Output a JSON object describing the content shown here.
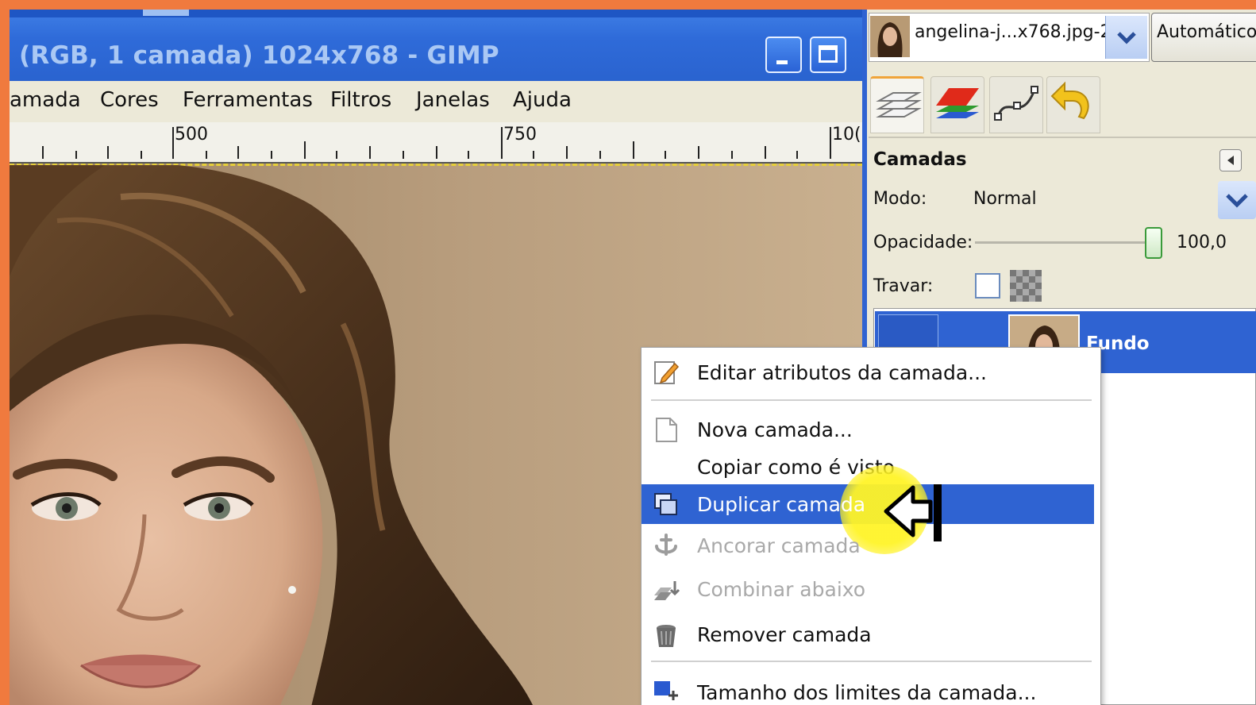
{
  "window": {
    "title": "(RGB, 1 camada) 1024x768 - GIMP"
  },
  "menubar": {
    "items": [
      "amada",
      "Cores",
      "Ferramentas",
      "Filtros",
      "Janelas",
      "Ajuda"
    ]
  },
  "ruler": {
    "labels": [
      "500",
      "750",
      "10("
    ]
  },
  "image_selector": {
    "name": "angelina-j...x768.jpg-2",
    "auto_button": "Automático"
  },
  "dock": {
    "tabs": [
      "layers-icon",
      "channels-icon",
      "paths-icon",
      "undo-icon"
    ],
    "panel_title": "Camadas",
    "mode_label": "Modo:",
    "mode_value": "Normal",
    "opacity_label": "Opacidade:",
    "opacity_value": "100,0",
    "opacity_level": 1.0,
    "lock_label": "Travar:",
    "layers": [
      {
        "name": "Fundo",
        "selected": true,
        "visible": true
      }
    ]
  },
  "context_menu": {
    "items": [
      {
        "label": "Editar atributos da camada...",
        "icon": "edit-icon",
        "enabled": true
      },
      {
        "label": "Nova camada...",
        "icon": "new-layer-icon",
        "enabled": true
      },
      {
        "label": "Copiar como é visto",
        "icon": "",
        "enabled": true
      },
      {
        "label": "Duplicar camada",
        "icon": "duplicate-icon",
        "enabled": true,
        "highlighted": true
      },
      {
        "label": "Ancorar camada",
        "icon": "anchor-icon",
        "enabled": false
      },
      {
        "label": "Combinar abaixo",
        "icon": "merge-down-icon",
        "enabled": false
      },
      {
        "label": "Remover camada",
        "icon": "trash-icon",
        "enabled": true
      },
      {
        "label": "Tamanho dos limites da camada...",
        "icon": "layer-boundary-icon",
        "enabled": true
      }
    ]
  },
  "colors": {
    "frame": "#f07a3e",
    "selection": "#2f63d2",
    "titlebar": "#2f6bd9",
    "cursor_highlight": "#fff428"
  }
}
